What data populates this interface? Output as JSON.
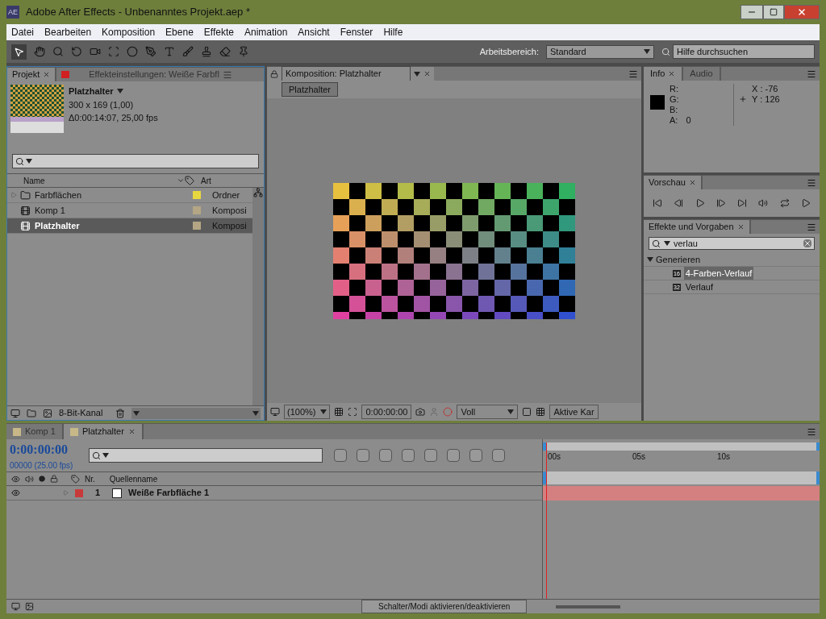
{
  "window": {
    "title": "Adobe After Effects - Unbenanntes Projekt.aep *",
    "app_badge": "AE"
  },
  "menu": [
    "Datei",
    "Bearbeiten",
    "Komposition",
    "Ebene",
    "Effekte",
    "Animation",
    "Ansicht",
    "Fenster",
    "Hilfe"
  ],
  "toolbar": {
    "workspace_label": "Arbeitsbereich:",
    "workspace": "Standard",
    "help_search": {
      "placeholder": "Hilfe durchsuchen"
    }
  },
  "project_panel": {
    "tabs": [
      {
        "label": "Projekt",
        "selected": true
      },
      {
        "label": "Effekteinstellungen: Weiße Farbfl",
        "selected": false
      }
    ],
    "item": {
      "name": "Platzhalter",
      "size": "300 x 169 (1,00)",
      "duration": "Δ0:00:14:07, 25,00 fps"
    },
    "columns": [
      "Name",
      "Art"
    ],
    "rows": [
      {
        "name": "Farbflächen",
        "kind": "folder",
        "color": "#e8d840",
        "type": "Ordner",
        "selected": false
      },
      {
        "name": "Komp 1",
        "kind": "composition",
        "color": "#b4a684",
        "type": "Komposi",
        "selected": false
      },
      {
        "name": "Platzhalter",
        "kind": "composition",
        "color": "#b4a684",
        "type": "Komposi",
        "selected": true
      }
    ],
    "bit_depth": "8-Bit-Kanal"
  },
  "comp_panel": {
    "tab": "Komposition: Platzhalter",
    "breadcrumb": "Platzhalter",
    "zoom": "(100%)",
    "time": "0:00:00:00",
    "resolution": "Voll",
    "camera": "Aktive Kar"
  },
  "info_panel": {
    "tabs": [
      {
        "label": "Info",
        "selected": true
      },
      {
        "label": "Audio",
        "selected": false
      }
    ],
    "channels": [
      {
        "label": "R:"
      },
      {
        "label": "G:"
      },
      {
        "label": "B:"
      },
      {
        "label": "A:",
        "value": "0"
      }
    ],
    "coords": [
      "X : -76",
      "Y : 126"
    ]
  },
  "preview_panel": {
    "tab": "Vorschau"
  },
  "effects_panel": {
    "tab": "Effekte und Vorgaben",
    "search": "verlau",
    "tree": [
      {
        "label": "Generieren",
        "expanded": true,
        "children": [
          {
            "label": "4-Farben-Verlauf",
            "badge": "16",
            "selected": true
          },
          {
            "label": "Verlauf",
            "badge": "32",
            "selected": false
          }
        ]
      }
    ]
  },
  "timeline": {
    "tabs": [
      {
        "label": "Komp 1",
        "selected": false
      },
      {
        "label": "Platzhalter",
        "selected": true
      }
    ],
    "timecode": "0:00:00:00",
    "fps": "00000 (25.00 fps)",
    "columns": [
      "Nr.",
      "Quellenname"
    ],
    "ticks": [
      "00s",
      "05s",
      "10s"
    ],
    "layers": [
      {
        "number": "1",
        "name": "Weiße Farbfläche 1",
        "color": "#c83a3a",
        "visible": true
      }
    ]
  },
  "status_bar": {
    "toggle": "Schalter/Modi aktivieren/deaktivieren"
  }
}
